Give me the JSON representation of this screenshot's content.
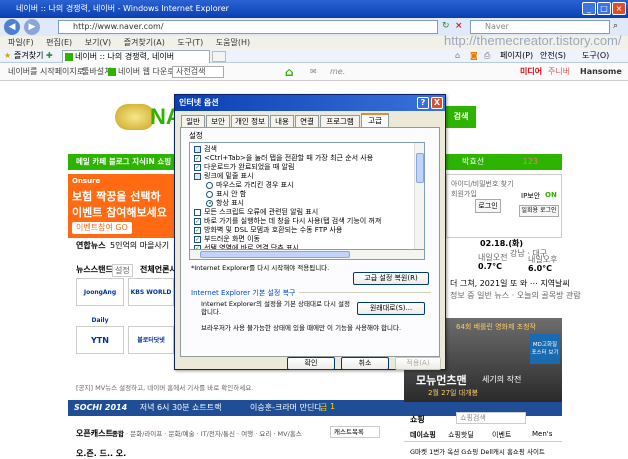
{
  "window": {
    "title": "네이버 :: 나의 경쟁력, 네이버 - Windows Internet Explorer",
    "address": "http://www.naver.com/",
    "search_placeholder": "Naver"
  },
  "menu": [
    "파일(F)",
    "편집(E)",
    "보기(V)",
    "즐겨찾기(A)",
    "도구(T)",
    "도움말(H)"
  ],
  "watermark": "http://themecreator.tistory.com/",
  "favorites": {
    "fav_label": "즐겨찾기",
    "tab_label": "네이버 :: 나의 경쟁력, 네이버"
  },
  "links_bar": {
    "items": [
      "네이버를 시작페이지로",
      "툴바설치",
      "네이버 웹 다운로드",
      "사전검색"
    ],
    "right_links": [
      "페이지(P)",
      "안전(S)",
      "도구(O)"
    ],
    "tools": [
      "미디어",
      "주니버",
      "Hansome"
    ]
  },
  "page": {
    "naver_logo": "NA",
    "search_btn": "검색",
    "greenbar_text": "메일  카페  블로그  지식iN  쇼핑",
    "ad_brand": "Onsure",
    "ad_line1": "보험 짝꿍을 선택하",
    "ad_line2": "이벤트 참여해보세요",
    "ad_cta": "이벤트참여 GO",
    "user_name": "박효선",
    "login": {
      "id_find": "아이디/비밀번호 찾기",
      "signup": "회원가입",
      "login_btn": "로그인",
      "ip_security": "IP보안",
      "ip_on": "ON",
      "onetime": "일회용 로그인"
    },
    "weather": {
      "date": "02.18.(화)",
      "location": "강남 · 대구",
      "temp1": "0.7°C",
      "temp2": "6.0°C",
      "label1": "내일오전",
      "label2": "내일오후"
    },
    "news_label": "연합뉴스",
    "news_text": "5인억의 마을사기",
    "news_stand": "뉴스스탠드",
    "news_setting": "설정",
    "news_all": "전체언론사",
    "press": [
      "JoongAng Daily",
      "KBS WORLD",
      "YTN",
      "블로터닷넷"
    ],
    "notice": "[공지] MV뉴스 설정하고, 네이버 홈에서 기사를 바로 확인하세요.",
    "sochi": "SOCHI 2014",
    "sochi_text": "저녁 6시 30분 쇼트트랙",
    "sochi_ticker": "이승훈-크라머 만딘다",
    "sochi_medal": "금",
    "sochi_count": "1",
    "opencast": "오픈캐스트",
    "opencast_tabs": [
      "종합",
      "문화/라이프",
      "문화/예술",
      "IT/전자/통신",
      "여행",
      "요리",
      "MV/홈스",
      "관련"
    ],
    "cast_sort": "캐스트목록",
    "bottom_left": "오.즌. 드.. 오.",
    "movie_title": "64회 베를린 영화제 초청작",
    "movie_big": "모뉴먼츠맨",
    "movie_sub1": "세기의 작전",
    "movie_sub2": "2월 27일 대개봉",
    "movie_badge": "MD고화질",
    "movie_badge2": "포스터 보기",
    "shopping": "쇼핑",
    "shop_search": "쇼핑검색",
    "shop_tabs": [
      "데이쇼핑",
      "쇼핑핫딜",
      "이벤트",
      "Men's"
    ],
    "shop_footer": "G마켓  1번가  옥션  G쇼핑  Dell캐시  홈쇼핑 사이트",
    "weather_news": "더 그쳐, 2021일 또 와 ⋯ 지역날씨",
    "weather_news2": "정보 중 일반 뉴스 · 오늘의 골목방  관람",
    "right_num": "123"
  },
  "dialog": {
    "title": "인터넷 옵션",
    "help_btn": "?",
    "close_btn": "X",
    "tabs": [
      "일반",
      "보안",
      "개인 정보",
      "내용",
      "연결",
      "프로그램",
      "고급"
    ],
    "active_tab": "고급",
    "settings_label": "설정",
    "tree": [
      {
        "type": "folder",
        "label": "검색"
      },
      {
        "type": "check",
        "checked": true,
        "label": "<Ctrl+Tab>을 눌러 탭을 전환할 때 가장 최근 순서 사용"
      },
      {
        "type": "check",
        "checked": true,
        "label": "다운로드가 완료되었을 때 알림"
      },
      {
        "type": "folder",
        "label": "링크에 밑줄 표시"
      },
      {
        "type": "radio",
        "checked": false,
        "label": "마우스로 가리킨 경우 표시"
      },
      {
        "type": "radio",
        "checked": false,
        "label": "표시 안 함"
      },
      {
        "type": "radio",
        "checked": true,
        "label": "항상 표시"
      },
      {
        "type": "check",
        "checked": false,
        "label": "모든 스크립트 오류에 관련된 알림 표시"
      },
      {
        "type": "check",
        "checked": true,
        "label": "바로 가기를 실행하는 데 창을 다시 사용(탭 검색 기능이 꺼져"
      },
      {
        "type": "check",
        "checked": true,
        "label": "방화벽 및 DSL 모뎀과 호환되는 수동 FTP 사용"
      },
      {
        "type": "check",
        "checked": true,
        "label": "부드러운 화면 이동"
      },
      {
        "type": "check",
        "checked": true,
        "label": "선택 영역에 바로 연결 단추 표시"
      }
    ],
    "restart_note": "*Internet Explorer를 다시 시작해야 적용됩니다.",
    "restore_advanced_btn": "고급 설정 복원(R)",
    "reset_group_title": "Internet Explorer 기본 설정 복구",
    "reset_text": "Internet Explorer의 설정을 기본 상태대로 다시 설정합니다.",
    "reset_btn": "원래대로(S)...",
    "reset_warning": "브라우저가 사용 불가능한 상태에 있을 때에만 이 기능을 사용해야 합니다.",
    "ok_btn": "확인",
    "cancel_btn": "취소",
    "apply_btn": "적용(A)"
  }
}
